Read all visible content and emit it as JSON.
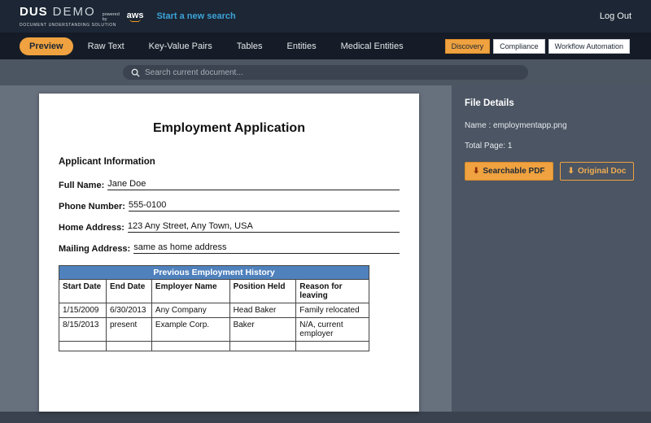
{
  "header": {
    "logo_dus": "DUS",
    "logo_demo": "DEMO",
    "logo_sub": "DOCUMENT UNDERSTANDING SOLUTION",
    "powered_by": "powered by",
    "aws_label": "aws",
    "new_search": "Start a new search",
    "logout": "Log Out"
  },
  "nav": {
    "tabs": [
      {
        "label": "Preview"
      },
      {
        "label": "Raw Text"
      },
      {
        "label": "Key-Value Pairs"
      },
      {
        "label": "Tables"
      },
      {
        "label": "Entities"
      },
      {
        "label": "Medical Entities"
      }
    ],
    "modes": [
      {
        "label": "Discovery"
      },
      {
        "label": "Compliance"
      },
      {
        "label": "Workflow Automation"
      }
    ]
  },
  "search": {
    "placeholder": "Search current document..."
  },
  "document": {
    "title": "Employment Application",
    "section_heading": "Applicant Information",
    "fields": [
      {
        "label": "Full Name:",
        "value": "Jane Doe"
      },
      {
        "label": "Phone Number:",
        "value": "555-0100"
      },
      {
        "label": "Home Address:",
        "value": "123 Any Street, Any Town, USA"
      },
      {
        "label": "Mailing Address:",
        "value": "same as home address"
      }
    ],
    "table": {
      "title": "Previous Employment History",
      "headers": [
        "Start Date",
        "End Date",
        "Employer Name",
        "Position Held",
        "Reason for leaving"
      ],
      "rows": [
        [
          "1/15/2009",
          "6/30/2013",
          "Any Company",
          "Head Baker",
          "Family relocated"
        ],
        [
          "8/15/2013",
          "present",
          "Example Corp.",
          "Baker",
          "N/A, current employer"
        ],
        [
          "",
          "",
          "",
          "",
          ""
        ]
      ]
    }
  },
  "sidebar": {
    "title": "File Details",
    "name_line": "Name : employmentapp.png",
    "total_page_line": "Total Page: 1",
    "download_icon": "⬇",
    "buttons": [
      {
        "label": "Searchable PDF"
      },
      {
        "label": "Original Doc"
      }
    ]
  },
  "colors": {
    "accent_orange": "#efa23f",
    "link_blue": "#3ba3d8",
    "table_header_blue": "#4f81bd",
    "topbar_bg": "#1c2634",
    "panel_bg": "#4b5563"
  }
}
